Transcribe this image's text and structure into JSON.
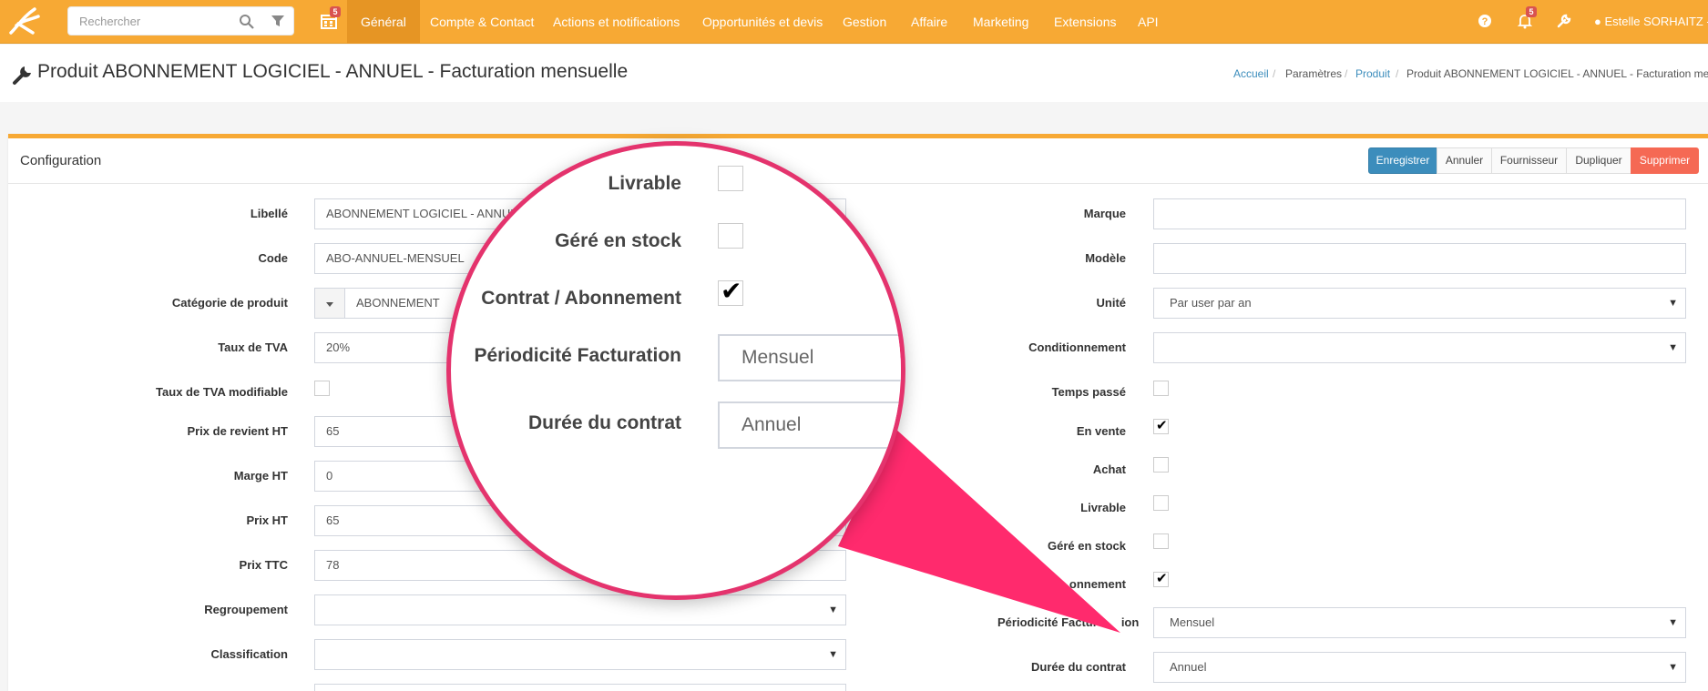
{
  "topbar": {
    "search_placeholder": "Rechercher",
    "calendar_badge": "5",
    "nav": [
      "Général",
      "Compte & Contact",
      "Actions et notifications",
      "Opportunités et devis",
      "Gestion",
      "Affaire",
      "Marketing",
      "Extensions",
      "API"
    ],
    "notif_badge": "5",
    "user": "Estelle SORHAITZ -"
  },
  "header": {
    "title": "Produit ABONNEMENT LOGICIEL - ANNUEL - Facturation mensuelle",
    "breadcrumb": {
      "home": "Accueil",
      "sep": "/",
      "params": "Paramètres",
      "product": "Produit",
      "current": "Produit ABONNEMENT LOGICIEL - ANNUEL - Facturation mensuelle"
    }
  },
  "panel": {
    "title": "Configuration",
    "buttons": {
      "save": "Enregistrer",
      "cancel": "Annuler",
      "supplier": "Fournisseur",
      "duplicate": "Dupliquer",
      "delete": "Supprimer"
    }
  },
  "left_form": {
    "libelle": {
      "label": "Libellé",
      "value": "ABONNEMENT LOGICIEL - ANNUEL"
    },
    "code": {
      "label": "Code",
      "value": "ABO-ANNUEL-MENSUEL"
    },
    "categorie": {
      "label": "Catégorie de produit",
      "value": "ABONNEMENT"
    },
    "tva": {
      "label": "Taux de TVA",
      "value": "20%"
    },
    "tva_mod": {
      "label": "Taux de TVA modifiable",
      "checked": false
    },
    "prix_revient": {
      "label": "Prix de revient HT",
      "value": "65"
    },
    "marge": {
      "label": "Marge HT",
      "value": "0"
    },
    "prix_ht": {
      "label": "Prix HT",
      "value": "65"
    },
    "prix_ttc": {
      "label": "Prix TTC",
      "value": "78"
    },
    "regroupement": {
      "label": "Regroupement",
      "value": ""
    },
    "classification": {
      "label": "Classification",
      "value": ""
    }
  },
  "right_form": {
    "marque": {
      "label": "Marque",
      "value": ""
    },
    "modele": {
      "label": "Modèle",
      "value": ""
    },
    "unite": {
      "label": "Unité",
      "value": "Par user par an"
    },
    "conditionnement": {
      "label": "Conditionnement",
      "value": ""
    },
    "temps_passe": {
      "label": "Temps passé",
      "checked": false
    },
    "en_vente": {
      "label": "En vente",
      "checked": true
    },
    "achat": {
      "label": "Achat",
      "checked": false
    },
    "livrable": {
      "label": "Livrable",
      "checked": false
    },
    "gere_stock": {
      "label": "Géré en stock",
      "checked": false
    },
    "contrat": {
      "label": "onnement",
      "checked": true
    },
    "periodicite": {
      "label": "Périodicité Factur",
      "label_tail": "ion",
      "value": "Mensuel"
    },
    "duree": {
      "label": "Durée du contrat",
      "value": "Annuel"
    }
  },
  "magnifier": {
    "livrable": "Livrable",
    "gere_stock": "Géré en stock",
    "contrat": "Contrat / Abonnement",
    "periodicite": "Périodicité Facturation",
    "periodicite_value": "Mensuel",
    "duree": "Durée du contrat",
    "duree_value": "Annuel"
  },
  "colors": {
    "topbar": "#f7a934",
    "primary": "#3c8dbc",
    "danger": "#f56954",
    "zoom_accent": "#e4336d",
    "arrow": "#ff2a6d"
  }
}
